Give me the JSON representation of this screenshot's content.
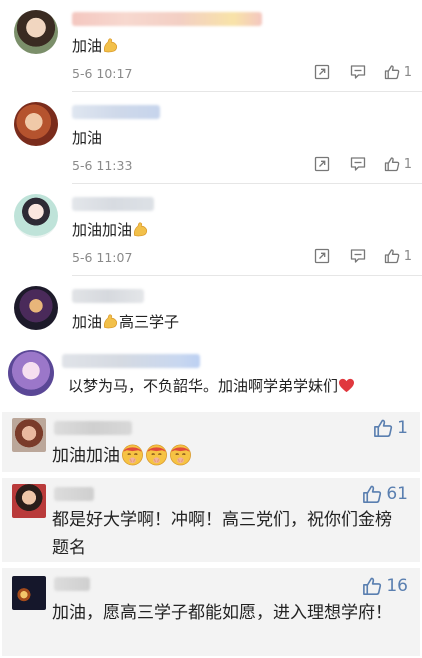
{
  "comments": [
    {
      "text": "加油",
      "time": "5-6 10:17",
      "likes": "1"
    },
    {
      "text": "加油",
      "time": "5-6 11:33",
      "likes": "1"
    },
    {
      "text": "加油加油",
      "time": "5-6 11:07",
      "likes": "1"
    },
    {
      "text": "加油",
      "text_suffix": "高三学子"
    },
    {
      "text": "以梦为马，不负韶华。加油啊学弟学妹们"
    }
  ],
  "cards": [
    {
      "text": "加油加油",
      "likes": "1"
    },
    {
      "text": "都是好大学啊！冲啊！高三党们，祝你们金榜题名",
      "likes": "61"
    },
    {
      "text": "加油，愿高三学子都能如愿，进入理想学府！",
      "likes": "16"
    }
  ],
  "icons": {
    "share": "share-icon",
    "reply": "comment-icon",
    "like": "thumbs-up-icon"
  },
  "colors": {
    "like_blue": "#5a7fb0",
    "meta_grey": "#8a8a8a",
    "heart_red": "#e0383e"
  }
}
